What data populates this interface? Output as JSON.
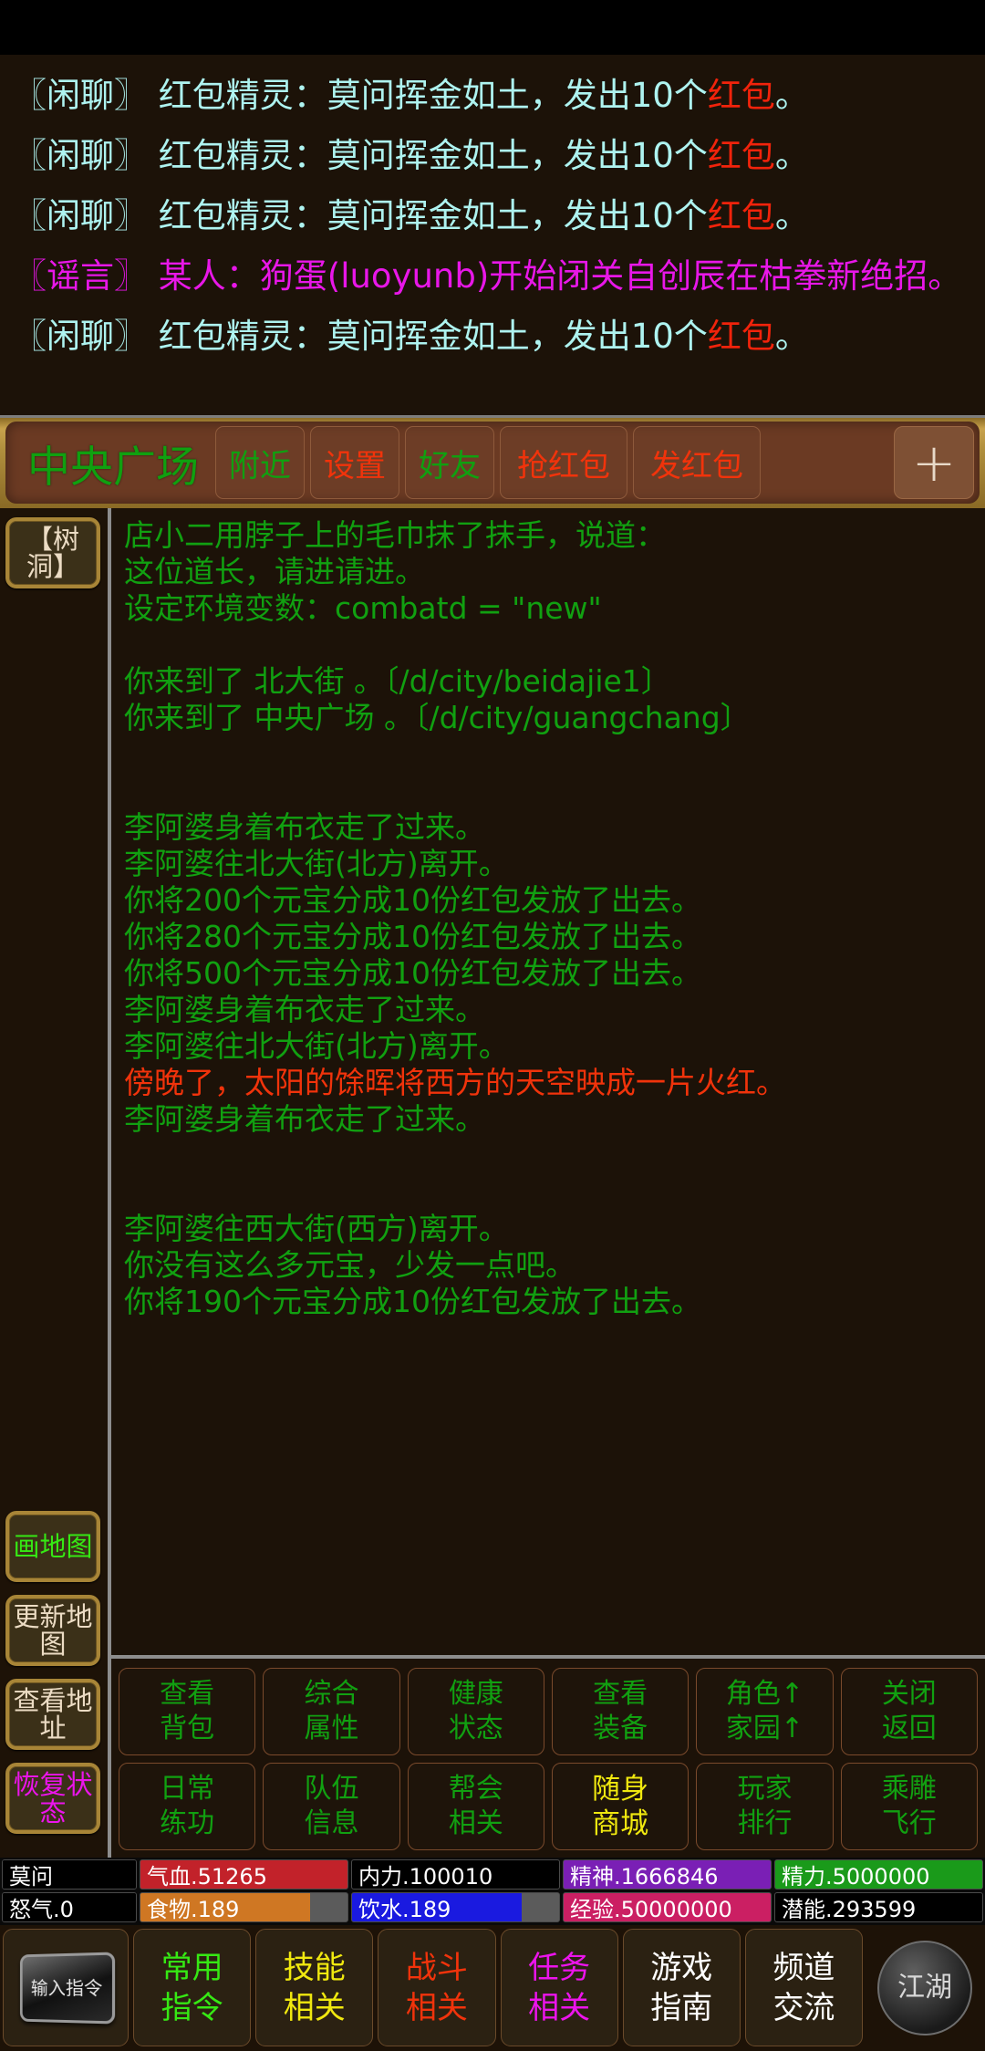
{
  "chat": {
    "lines": [
      {
        "tag": "〖闲聊〗",
        "body": " 红包精灵：莫问挥金如土，发出10个",
        "highlight": "红包",
        "tail": "。",
        "type": "chat"
      },
      {
        "tag": "〖闲聊〗",
        "body": " 红包精灵：莫问挥金如土，发出10个",
        "highlight": "红包",
        "tail": "。",
        "type": "chat"
      },
      {
        "tag": "〖闲聊〗",
        "body": " 红包精灵：莫问挥金如土，发出10个",
        "highlight": "红包",
        "tail": "。",
        "type": "chat"
      },
      {
        "tag": "〖谣言〗",
        "body": " 某人：狗蛋(luoyunb)开始闭关自创辰在枯拳新绝招。",
        "highlight": "",
        "tail": "",
        "type": "rumor"
      },
      {
        "tag": "〖闲聊〗",
        "body": " 红包精灵：莫问挥金如土，发出10个",
        "highlight": "红包",
        "tail": "。",
        "type": "chat"
      }
    ]
  },
  "nav": {
    "location": "中央广场",
    "buttons": [
      {
        "label": "附近",
        "color": "green"
      },
      {
        "label": "设置",
        "color": "red"
      },
      {
        "label": "好友",
        "color": "green"
      },
      {
        "label": "抢红包",
        "color": "red"
      },
      {
        "label": "发红包",
        "color": "red"
      }
    ],
    "add_label": "+"
  },
  "rail": {
    "top": [
      {
        "label": "【树洞】",
        "color": "cream"
      }
    ],
    "bottom": [
      {
        "label": "画地图",
        "color": "green"
      },
      {
        "label": "更新地图",
        "color": "cream"
      },
      {
        "label": "查看地址",
        "color": "cream"
      },
      {
        "label": "恢复状态",
        "color": "magenta"
      }
    ]
  },
  "game_log": [
    {
      "text": "店小二用脖子上的毛巾抹了抹手，说道：",
      "color": "green"
    },
    {
      "text": "这位道长，请进请进。",
      "color": "green"
    },
    {
      "text": "设定环境变数：combatd = \"new\"",
      "color": "green"
    },
    {
      "text": "",
      "color": "green"
    },
    {
      "text": "你来到了 北大街 。〔/d/city/beidajie1〕",
      "color": "green"
    },
    {
      "text": "你来到了 中央广场 。〔/d/city/guangchang〕",
      "color": "green"
    },
    {
      "text": "",
      "color": "green"
    },
    {
      "text": "",
      "color": "green"
    },
    {
      "text": "李阿婆身着布衣走了过来。",
      "color": "green"
    },
    {
      "text": "李阿婆往北大街(北方)离开。",
      "color": "green"
    },
    {
      "text": "你将200个元宝分成10份红包发放了出去。",
      "color": "green"
    },
    {
      "text": "你将280个元宝分成10份红包发放了出去。",
      "color": "green"
    },
    {
      "text": "你将500个元宝分成10份红包发放了出去。",
      "color": "green"
    },
    {
      "text": "李阿婆身着布衣走了过来。",
      "color": "green"
    },
    {
      "text": "李阿婆往北大街(北方)离开。",
      "color": "green"
    },
    {
      "text": "傍晚了，太阳的馀晖将西方的天空映成一片火红。",
      "color": "red"
    },
    {
      "text": "李阿婆身着布衣走了过来。",
      "color": "green"
    },
    {
      "text": "",
      "color": "green"
    },
    {
      "text": "",
      "color": "green"
    },
    {
      "text": "李阿婆往西大街(西方)离开。",
      "color": "green"
    },
    {
      "text": "你没有这么多元宝，少发一点吧。",
      "color": "green"
    },
    {
      "text": "你将190个元宝分成10份红包发放了出去。",
      "color": "green"
    }
  ],
  "commands": [
    {
      "l1": "查看",
      "l2": "背包",
      "hl": false
    },
    {
      "l1": "综合",
      "l2": "属性",
      "hl": false
    },
    {
      "l1": "健康",
      "l2": "状态",
      "hl": false
    },
    {
      "l1": "查看",
      "l2": "装备",
      "hl": false
    },
    {
      "l1": "角色↑",
      "l2": "家园↑",
      "hl": false
    },
    {
      "l1": "关闭",
      "l2": "返回",
      "hl": false
    },
    {
      "l1": "日常",
      "l2": "练功",
      "hl": false
    },
    {
      "l1": "队伍",
      "l2": "信息",
      "hl": false
    },
    {
      "l1": "帮会",
      "l2": "相关",
      "hl": false
    },
    {
      "l1": "随身",
      "l2": "商城",
      "hl": true
    },
    {
      "l1": "玩家",
      "l2": "排行",
      "hl": false
    },
    {
      "l1": "乘雕",
      "l2": "飞行",
      "hl": false
    }
  ],
  "status": {
    "row1": [
      {
        "label": "莫问",
        "color": "#000000",
        "pct": 100,
        "name": true
      },
      {
        "label": "气血.51265",
        "color": "#c2222a",
        "pct": 100
      },
      {
        "label": "内力.100010",
        "color": "#000000",
        "pct": 100
      },
      {
        "label": "精神.1666846",
        "color": "#7a1fb5",
        "pct": 100
      },
      {
        "label": "精力.5000000",
        "color": "#1a9a1a",
        "pct": 100
      }
    ],
    "row2": [
      {
        "label": "怒气.0",
        "color": "#000000",
        "pct": 100,
        "name": true
      },
      {
        "label": "食物.189",
        "color": "#cf7723",
        "pct": 82
      },
      {
        "label": "饮水.189",
        "color": "#1a1ae0",
        "pct": 82
      },
      {
        "label": "经验.50000000",
        "color": "#cb1f63",
        "pct": 100
      },
      {
        "label": "潜能.293599",
        "color": "#000000",
        "pct": 100
      }
    ]
  },
  "toolbar": {
    "input_label": "输入指令",
    "buttons": [
      {
        "l1": "常用",
        "l2": "指令",
        "color": "green"
      },
      {
        "l1": "技能",
        "l2": "相关",
        "color": "yellow"
      },
      {
        "l1": "战斗",
        "l2": "相关",
        "color": "red"
      },
      {
        "l1": "任务",
        "l2": "相关",
        "color": "magenta"
      },
      {
        "l1": "游戏",
        "l2": "指南",
        "color": "white"
      },
      {
        "l1": "频道",
        "l2": "交流",
        "color": "white"
      }
    ],
    "logo_label": "江湖"
  }
}
